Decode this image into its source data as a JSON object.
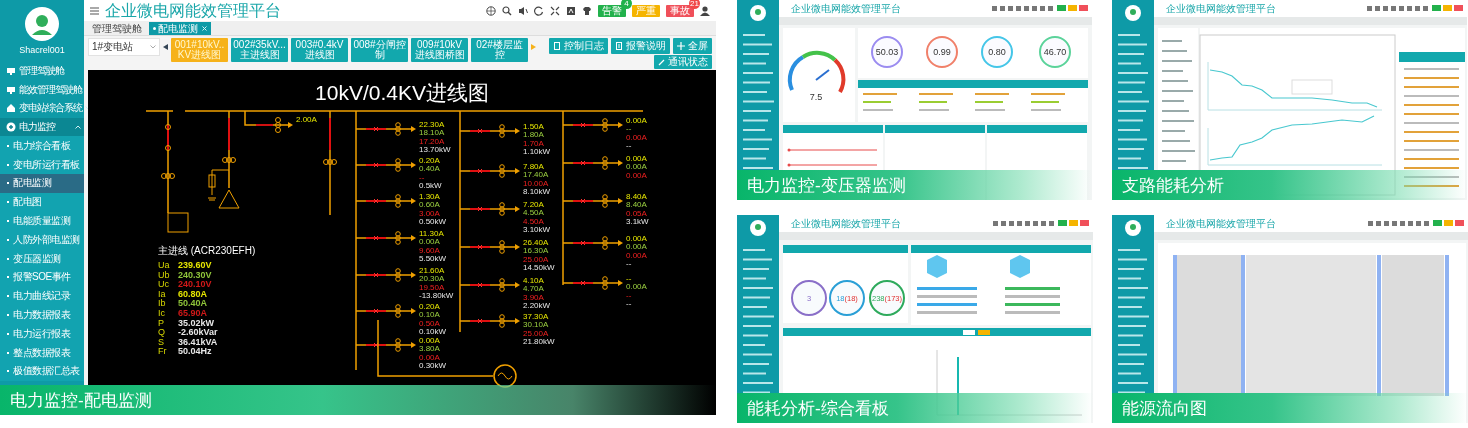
{
  "main": {
    "caption": "电力监控-配电监测",
    "app_title": "企业微电网能效管理平台",
    "user": "Shacrel001",
    "menu": [
      {
        "kind": "group",
        "label": "管理驾驶舱",
        "expanded": false
      },
      {
        "kind": "group",
        "label": "能效管理驾驶舱",
        "expanded": false
      },
      {
        "kind": "group",
        "label": "变电站综合系统",
        "expanded": false
      },
      {
        "kind": "group",
        "label": "电力监控",
        "expanded": true
      },
      {
        "kind": "item",
        "label": "电力综合看板",
        "selected": false
      },
      {
        "kind": "item",
        "label": "变电所运行看板",
        "selected": false
      },
      {
        "kind": "item",
        "label": "配电监测",
        "selected": true
      },
      {
        "kind": "item",
        "label": "配电图",
        "selected": false
      },
      {
        "kind": "item",
        "label": "电能质量监测",
        "selected": false
      },
      {
        "kind": "item",
        "label": "人防外部电监测",
        "selected": false
      },
      {
        "kind": "item",
        "label": "变压器监测",
        "selected": false
      },
      {
        "kind": "item",
        "label": "报警SOE事件",
        "selected": false
      },
      {
        "kind": "item",
        "label": "电力曲线记录",
        "selected": false
      },
      {
        "kind": "item",
        "label": "电力数据报表",
        "selected": false
      },
      {
        "kind": "item",
        "label": "电力运行报表",
        "selected": false
      },
      {
        "kind": "item",
        "label": "整点数据报表",
        "selected": false
      },
      {
        "kind": "item",
        "label": "极值数据汇总表",
        "selected": false
      }
    ],
    "tabs": [
      {
        "label": "管理驾驶舱",
        "selected": false
      },
      {
        "label": "配电监测",
        "selected": true
      }
    ],
    "station_select": "1#变电站",
    "diagram_buttons": [
      {
        "label": "001#10kV..KV进线图",
        "selected": true
      },
      {
        "label": "002#35kV...主进线图",
        "selected": false
      },
      {
        "label": "003#0.4kV进线图",
        "selected": false
      },
      {
        "label": "008#分闸控制",
        "selected": false
      },
      {
        "label": "009#10kV进线图桥图",
        "selected": false
      },
      {
        "label": "02#楼层监控",
        "selected": false
      }
    ],
    "tool_buttons": [
      "控制日志",
      "报警说明",
      "全屏"
    ],
    "status_button": "通讯状态",
    "alarm_badges": [
      {
        "label": "告警",
        "count": "4",
        "color": "#22b14c"
      },
      {
        "label": "严重",
        "color": "#f5b400"
      },
      {
        "label": "事故",
        "count": "21",
        "color": "#f0505a"
      }
    ],
    "diagram": {
      "title": "10kV/0.4KV进线图",
      "top_reading": "2.00A",
      "columns": [
        {
          "feeders": [
            [
              "22.30A",
              "18.10A",
              "17.20A",
              "13.70kW"
            ],
            [
              "0.20A",
              "0.40A",
              "--",
              "0.5kW"
            ],
            [
              "1.30A",
              "0.60A",
              "3.00A",
              "0.50kW"
            ],
            [
              "11.30A",
              "0.00A",
              "9.60A",
              "5.50kW"
            ],
            [
              "21.60A",
              "20.30A",
              "19.50A",
              "-13.80kW"
            ],
            [
              "0.20A",
              "0.10A",
              "0.50A",
              "0.10kW"
            ],
            [
              "0.00A",
              "3.80A",
              "0.00A",
              "0.30kW"
            ]
          ]
        },
        {
          "feeders": [
            [
              "1.50A",
              "1.80A",
              "1.70A",
              "1.10kW"
            ],
            [
              "7.80A",
              "17.40A",
              "10.00A",
              "8.10kW"
            ],
            [
              "7.20A",
              "4.50A",
              "4.50A",
              "3.10kW"
            ],
            [
              "26.40A",
              "16.30A",
              "25.00A",
              "14.50kW"
            ],
            [
              "4.10A",
              "4.70A",
              "3.90A",
              "2.20kW"
            ],
            [
              "37.30A",
              "30.10A",
              "25.00A",
              "21.80kW"
            ]
          ]
        },
        {
          "feeders": [
            [
              "0.00A",
              "--",
              "0.00A",
              "--"
            ],
            [
              "0.00A",
              "0.00A",
              "0.00A"
            ],
            [
              "8.40A",
              "8.40A",
              "0.05A",
              "3.1kW"
            ],
            [
              "0.00A",
              "0.00A",
              "0.00A",
              "--"
            ],
            [
              "--",
              "0.00A",
              "--",
              "--"
            ]
          ]
        }
      ],
      "incoming": {
        "title": "主进线 (ACR230EFH)",
        "rows": [
          {
            "key": "Ua",
            "value": "239.60V",
            "color": "#e6e600"
          },
          {
            "key": "Ub",
            "value": "240.30V",
            "color": "#8fc43a"
          },
          {
            "key": "Uc",
            "value": "240.10V",
            "color": "#d01818"
          },
          {
            "key": "Ia",
            "value": "60.80A",
            "color": "#e6e600"
          },
          {
            "key": "Ib",
            "value": "50.40A",
            "color": "#8fc43a"
          },
          {
            "key": "Ic",
            "value": "65.90A",
            "color": "#d01818"
          },
          {
            "key": "P",
            "value": "35.02kW",
            "color": "#e8e8e8"
          },
          {
            "key": "Q",
            "value": "-2.60kVar",
            "color": "#e8e8e8"
          },
          {
            "key": "S",
            "value": "36.41kVA",
            "color": "#e8e8e8"
          },
          {
            "key": "Fr",
            "value": "50.04Hz",
            "color": "#e8e8e8"
          }
        ]
      }
    }
  },
  "thumbnails": [
    {
      "kind": "transformer",
      "caption": "电力监控-变压器监测",
      "app_title": "企业微电网能效管理平台",
      "gauge_value": "7.5",
      "rings": [
        {
          "value": "50.03",
          "color": "#9b8cf0"
        },
        {
          "value": "0.99",
          "color": "#f0806a"
        },
        {
          "value": "0.80",
          "color": "#45c6e8"
        },
        {
          "value": "46.70",
          "color": "#5bd39a"
        }
      ]
    },
    {
      "kind": "branch",
      "caption": "支路能耗分析",
      "app_title": "企业微电网能效管理平台"
    },
    {
      "kind": "dashboard",
      "caption": "能耗分析-综合看板",
      "app_title": "企业微电网能效管理平台",
      "stats": [
        {
          "value": "3",
          "color": "#8a6fc8"
        },
        {
          "value": "18",
          "extra": "(18)",
          "color": "#2a9fd6"
        },
        {
          "value": "238",
          "extra": "(173)",
          "color": "#2eaa5c"
        }
      ]
    },
    {
      "kind": "sankey",
      "caption": "能源流向图",
      "app_title": "企业微电网能效管理平台"
    }
  ]
}
